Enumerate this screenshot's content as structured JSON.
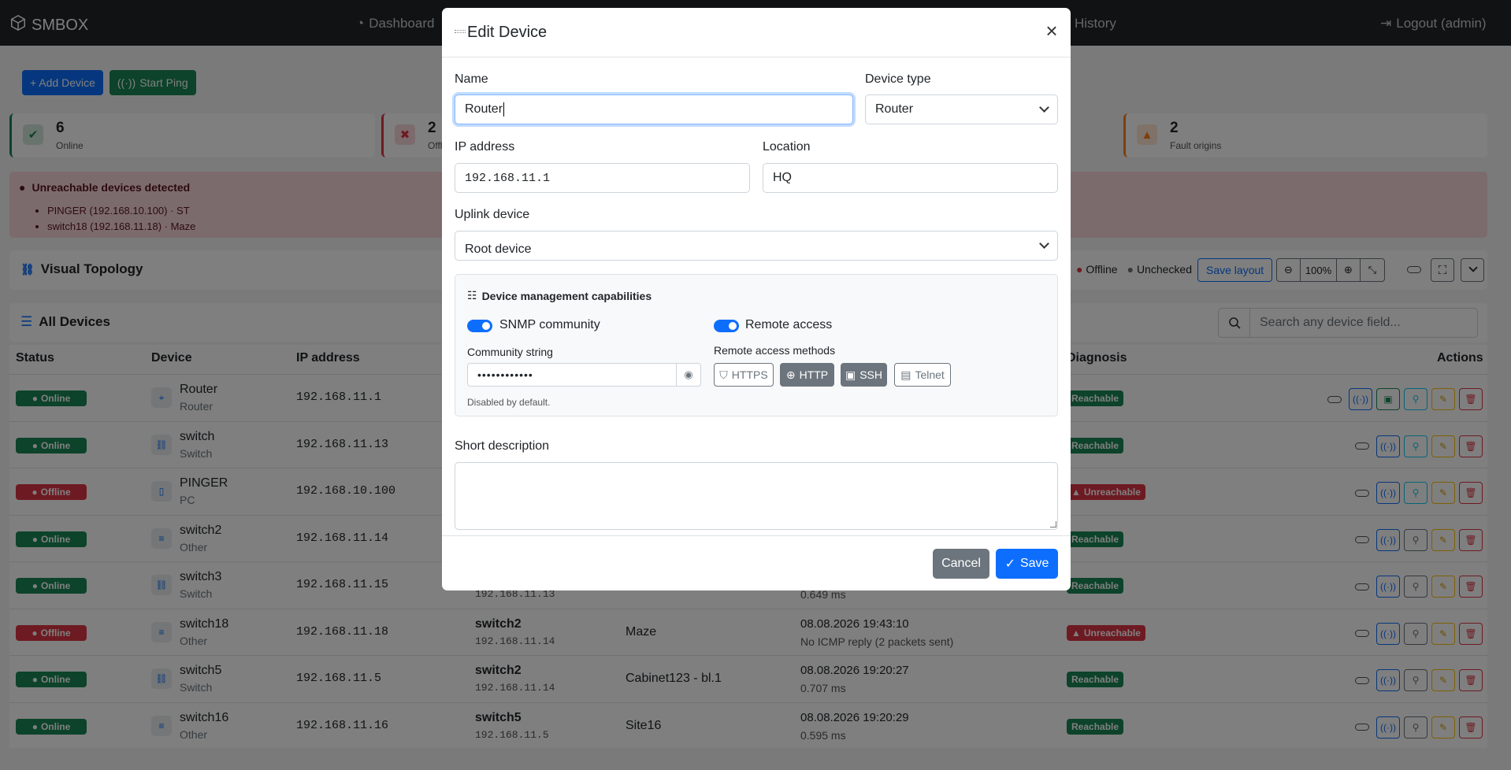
{
  "navbar": {
    "brand": "SMBOX",
    "dashboard": "Dashboard",
    "history": "History",
    "logout": "Logout (admin)"
  },
  "toolbar": {
    "add_device": "+ Add Device",
    "start_ping": "Start Ping"
  },
  "stats": [
    {
      "value": "6",
      "label": "Online",
      "color": "#198754"
    },
    {
      "value": "2",
      "label": "Offli",
      "color": "#dc3545"
    },
    {
      "value": "2",
      "label": "Fault origins",
      "color": "#fd7e14"
    }
  ],
  "alert": {
    "title": "Unreachable devices detected",
    "items": [
      "PINGER (192.168.10.100) · ST",
      "switch18 (192.168.11.18) · Maze"
    ]
  },
  "topology": {
    "title": "Visual Topology",
    "legend_offline": "Offline",
    "legend_unchecked": "Unchecked",
    "save_layout": "Save layout",
    "zoom": "100%"
  },
  "devices_card": {
    "title": "All Devices",
    "search_placeholder": "Search any device field..."
  },
  "table": {
    "headers": {
      "status": "Status",
      "device": "Device",
      "ip": "IP address",
      "diagnosis": "Diagnosis",
      "actions": "Actions"
    },
    "rows": [
      {
        "status": "Online",
        "name": "Router",
        "type": "Router",
        "ip": "192.168.11.1",
        "uplink": "",
        "uplink_ip": "",
        "location": "",
        "last_check": "",
        "detail": "",
        "diagnosis": "Reachable"
      },
      {
        "status": "Online",
        "name": "switch",
        "type": "Switch",
        "ip": "192.168.11.13",
        "uplink": "",
        "uplink_ip": "",
        "location": "",
        "last_check": "",
        "detail": "",
        "diagnosis": "Reachable"
      },
      {
        "status": "Offline",
        "name": "PINGER",
        "type": "PC",
        "ip": "192.168.10.100",
        "uplink": "",
        "uplink_ip": "",
        "location": "",
        "last_check": "",
        "detail": "",
        "diagnosis": "Unreachable"
      },
      {
        "status": "Online",
        "name": "switch2",
        "type": "Other",
        "ip": "192.168.11.14",
        "uplink": "",
        "uplink_ip": "",
        "location": "",
        "last_check": "",
        "detail": "",
        "diagnosis": "Reachable"
      },
      {
        "status": "Online",
        "name": "switch3",
        "type": "Switch",
        "ip": "192.168.11.15",
        "uplink": "",
        "uplink_ip": "192.168.11.13",
        "location": "",
        "last_check": "",
        "detail": "0.649 ms",
        "diagnosis": "Reachable"
      },
      {
        "status": "Offline",
        "name": "switch18",
        "type": "Other",
        "ip": "192.168.11.18",
        "uplink": "switch2",
        "uplink_ip": "192.168.11.14",
        "location": "Maze",
        "last_check": "08.08.2026 19:43:10",
        "detail": "No ICMP reply (2 packets sent)",
        "diagnosis": "Unreachable"
      },
      {
        "status": "Online",
        "name": "switch5",
        "type": "Switch",
        "ip": "192.168.11.5",
        "uplink": "switch2",
        "uplink_ip": "192.168.11.14",
        "location": "Cabinet123 - bl.1",
        "last_check": "08.08.2026 19:20:27",
        "detail": "0.707 ms",
        "diagnosis": "Reachable"
      },
      {
        "status": "Online",
        "name": "switch16",
        "type": "Other",
        "ip": "192.168.11.16",
        "uplink": "switch5",
        "uplink_ip": "192.168.11.5",
        "location": "Site16",
        "last_check": "08.08.2026 19:20:29",
        "detail": "0.595 ms",
        "diagnosis": "Reachable"
      }
    ]
  },
  "modal": {
    "title": "Edit Device",
    "name_label": "Name",
    "name_value": "Router",
    "type_label": "Device type",
    "type_value": "Router",
    "ip_label": "IP address",
    "ip_value": "192.168.11.1",
    "location_label": "Location",
    "location_value": "HQ",
    "uplink_label": "Uplink device",
    "uplink_value": "Root device",
    "capabilities": {
      "title": "Device management capabilities",
      "snmp_label": "SNMP community",
      "snmp_enabled": true,
      "community_label": "Community string",
      "community_value": "••••••••••••",
      "community_hint": "Disabled by default.",
      "remote_label": "Remote access",
      "remote_enabled": true,
      "methods_label": "Remote access methods",
      "methods": [
        {
          "label": "HTTPS",
          "active": false
        },
        {
          "label": "HTTP",
          "active": true
        },
        {
          "label": "SSH",
          "active": true
        },
        {
          "label": "Telnet",
          "active": false
        }
      ]
    },
    "description_label": "Short description",
    "description_value": "",
    "cancel": "Cancel",
    "save": "Save"
  },
  "colors": {
    "primary": "#0d6efd",
    "success": "#198754",
    "danger": "#dc3545",
    "secondary": "#6c757d",
    "warning": "#ffc107",
    "info": "#0dcaf0"
  }
}
